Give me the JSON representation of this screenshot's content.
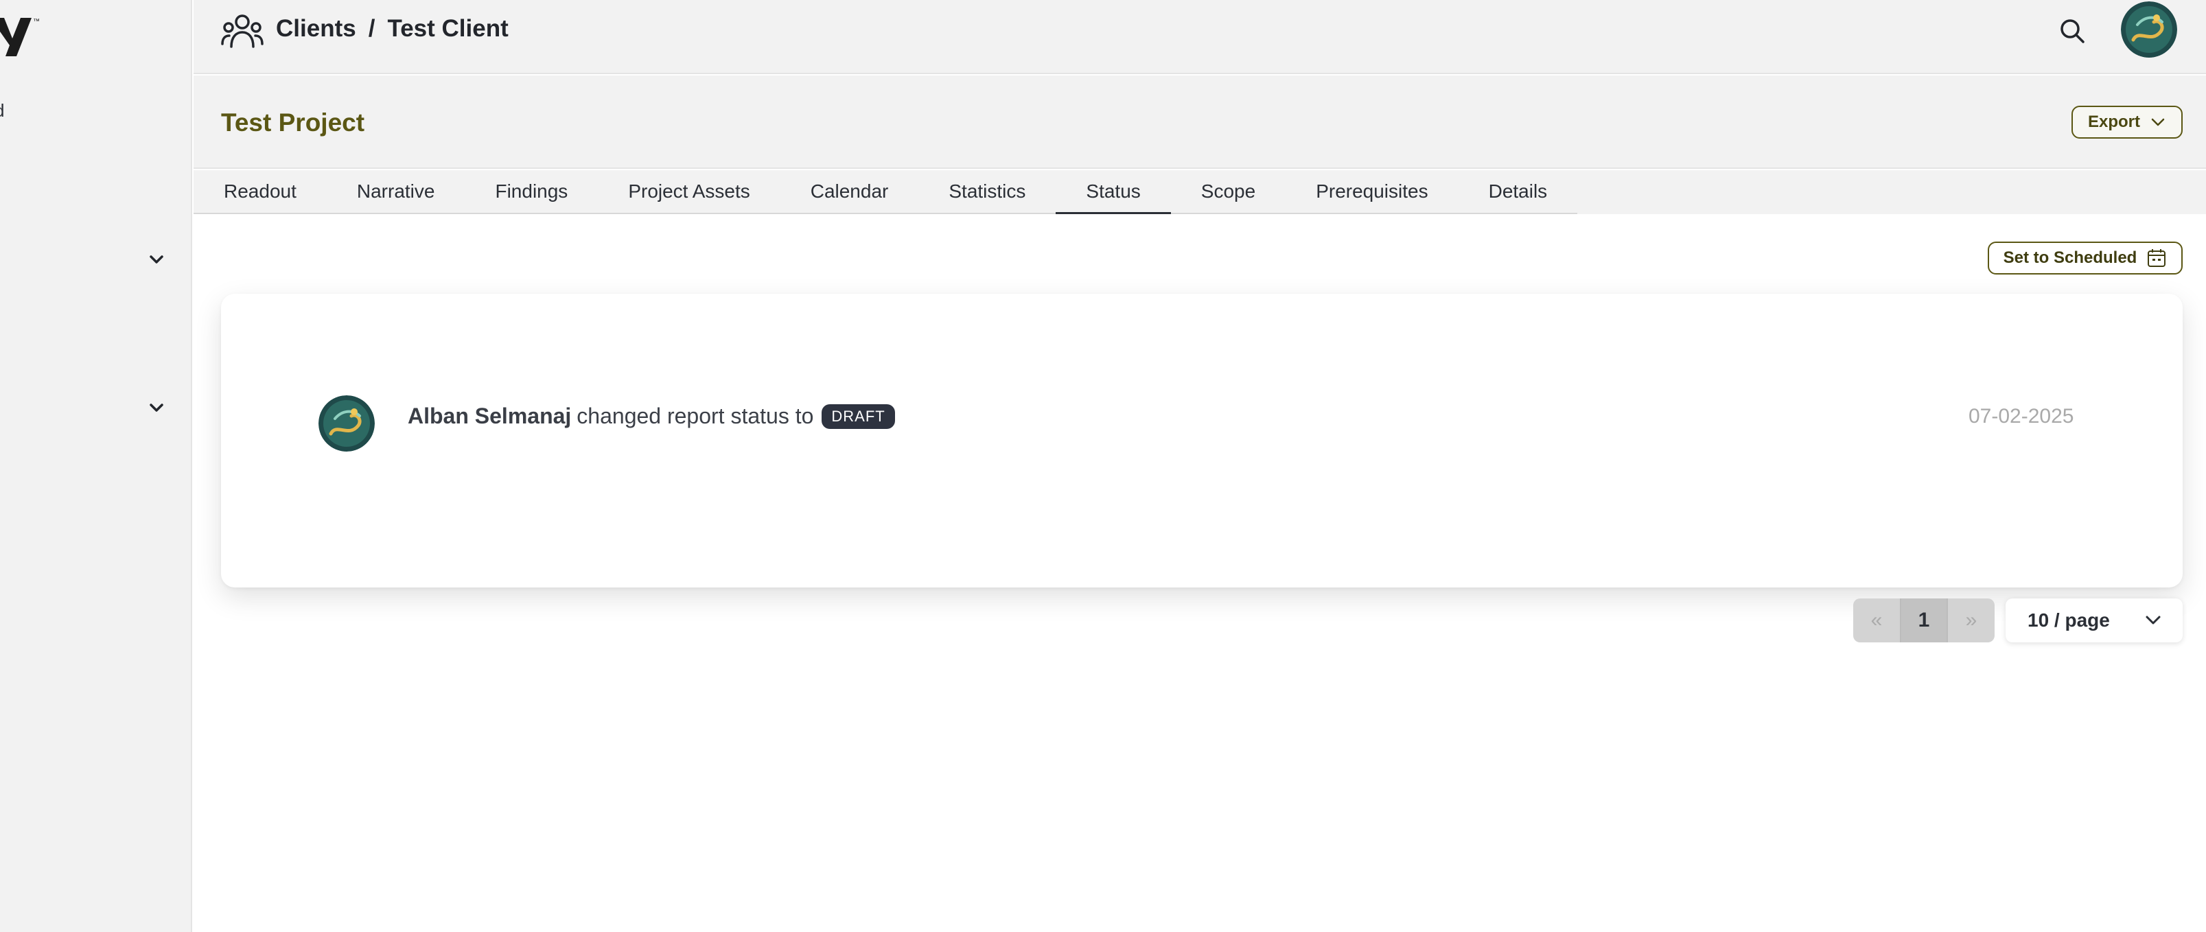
{
  "sidebar": {
    "logo_icon": "brand-logo-icon",
    "cut_label": "d",
    "chevrons": [
      "chevron-down-icon",
      "chevron-down-icon"
    ]
  },
  "header": {
    "icon": "users-group-icon",
    "breadcrumb": [
      "Clients",
      "/",
      "Test Client"
    ],
    "search_icon": "search-icon",
    "avatar": "user-avatar"
  },
  "project": {
    "title": "Test Project",
    "export_label": "Export"
  },
  "tabs": [
    {
      "label": "Readout",
      "active": false
    },
    {
      "label": "Narrative",
      "active": false
    },
    {
      "label": "Findings",
      "active": false
    },
    {
      "label": "Project Assets",
      "active": false
    },
    {
      "label": "Calendar",
      "active": false
    },
    {
      "label": "Statistics",
      "active": false
    },
    {
      "label": "Status",
      "active": true
    },
    {
      "label": "Scope",
      "active": false
    },
    {
      "label": "Prerequisites",
      "active": false
    },
    {
      "label": "Details",
      "active": false
    }
  ],
  "actions": {
    "set_scheduled_label": "Set to Scheduled",
    "set_scheduled_icon": "calendar-icon"
  },
  "status_log": [
    {
      "user": "Alban Selmanaj",
      "action": "changed report status to",
      "status": "DRAFT",
      "date": "07-02-2025"
    }
  ],
  "pagination": {
    "prev": "«",
    "current_page": "1",
    "next": "»",
    "page_size": "10 / page"
  },
  "colors": {
    "accent_olive": "#5b5714",
    "badge_dark": "#2e3340",
    "panel_gray": "#f2f2f2"
  }
}
